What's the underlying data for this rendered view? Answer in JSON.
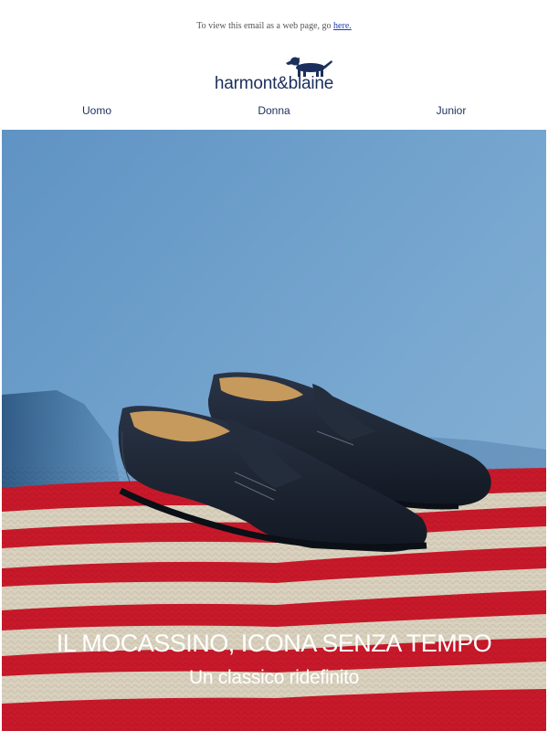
{
  "preheader": {
    "text": "To view this email as a web page, go ",
    "link_label": "here."
  },
  "brand": {
    "logo_text": "harmont&blaine",
    "logo_icon": "dachshund-icon",
    "color": "#1b2f5c"
  },
  "nav": {
    "items": [
      {
        "label": "Uomo"
      },
      {
        "label": "Donna"
      },
      {
        "label": "Junior"
      }
    ]
  },
  "hero": {
    "title": "IL MOCASSINO, ICONA SENZA TEMPO",
    "subtitle": "Un classico ridefinito",
    "image_subject": "navy-penny-loafers-on-red-striped-rug",
    "colors": {
      "sky": "#6f9fc9",
      "stripe_red": "#c8192a",
      "stripe_cream": "#d9d1bd",
      "shoe": "#1c2533"
    }
  }
}
